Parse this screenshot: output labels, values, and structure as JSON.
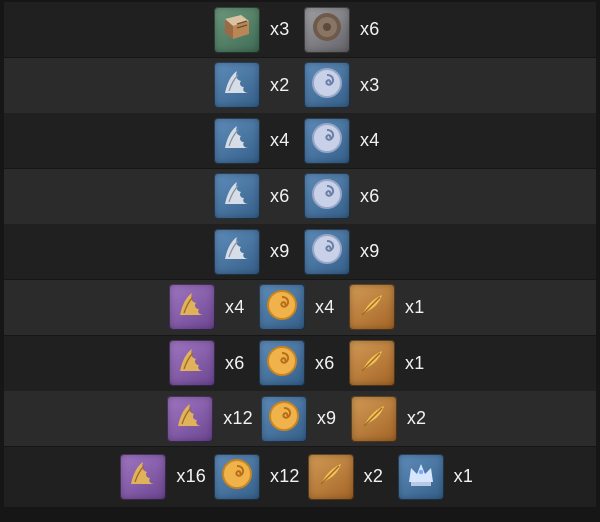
{
  "colors": {
    "rarity_green": "#5a8a6a",
    "rarity_gray": "#8a8a8e",
    "rarity_blue": "#4e79a6",
    "rarity_purple": "#8b62a8",
    "rarity_orange": "#c98a45"
  },
  "rows": [
    {
      "items": [
        {
          "icon": "bound-book-icon",
          "rarity": "green",
          "qty": "x3"
        },
        {
          "icon": "stone-disc-icon",
          "rarity": "gray",
          "qty": "x6"
        }
      ]
    },
    {
      "items": [
        {
          "icon": "silver-wing-icon",
          "rarity": "blue",
          "qty": "x2"
        },
        {
          "icon": "silver-swirl-disc-icon",
          "rarity": "blue",
          "qty": "x3"
        }
      ]
    },
    {
      "items": [
        {
          "icon": "silver-wing-icon",
          "rarity": "blue",
          "qty": "x4"
        },
        {
          "icon": "silver-swirl-disc-icon",
          "rarity": "blue",
          "qty": "x4"
        }
      ]
    },
    {
      "items": [
        {
          "icon": "silver-wing-icon",
          "rarity": "blue",
          "qty": "x6"
        },
        {
          "icon": "silver-swirl-disc-icon",
          "rarity": "blue",
          "qty": "x6"
        }
      ]
    },
    {
      "items": [
        {
          "icon": "silver-wing-icon",
          "rarity": "blue",
          "qty": "x9"
        },
        {
          "icon": "silver-swirl-disc-icon",
          "rarity": "blue",
          "qty": "x9"
        }
      ]
    },
    {
      "items": [
        {
          "icon": "gold-wing-icon",
          "rarity": "purple",
          "qty": "x4"
        },
        {
          "icon": "gold-swirl-disc-icon",
          "rarity": "blue",
          "qty": "x4"
        },
        {
          "icon": "gold-feather-icon",
          "rarity": "orange",
          "qty": "x1"
        }
      ]
    },
    {
      "items": [
        {
          "icon": "gold-wing-icon",
          "rarity": "purple",
          "qty": "x6"
        },
        {
          "icon": "gold-swirl-disc-icon",
          "rarity": "blue",
          "qty": "x6"
        },
        {
          "icon": "gold-feather-icon",
          "rarity": "orange",
          "qty": "x1"
        }
      ]
    },
    {
      "items": [
        {
          "icon": "gold-wing-icon",
          "rarity": "purple",
          "qty": "x12"
        },
        {
          "icon": "gold-swirl-disc-icon",
          "rarity": "blue",
          "qty": "x9"
        },
        {
          "icon": "gold-feather-icon",
          "rarity": "orange",
          "qty": "x2"
        }
      ]
    },
    {
      "items": [
        {
          "icon": "gold-wing-icon",
          "rarity": "purple",
          "qty": "x16"
        },
        {
          "icon": "gold-swirl-disc-icon",
          "rarity": "blue",
          "qty": "x12"
        },
        {
          "icon": "gold-feather-icon",
          "rarity": "orange",
          "qty": "x2"
        },
        {
          "icon": "crystal-crown-icon",
          "rarity": "blue",
          "qty": "x1"
        }
      ]
    }
  ]
}
